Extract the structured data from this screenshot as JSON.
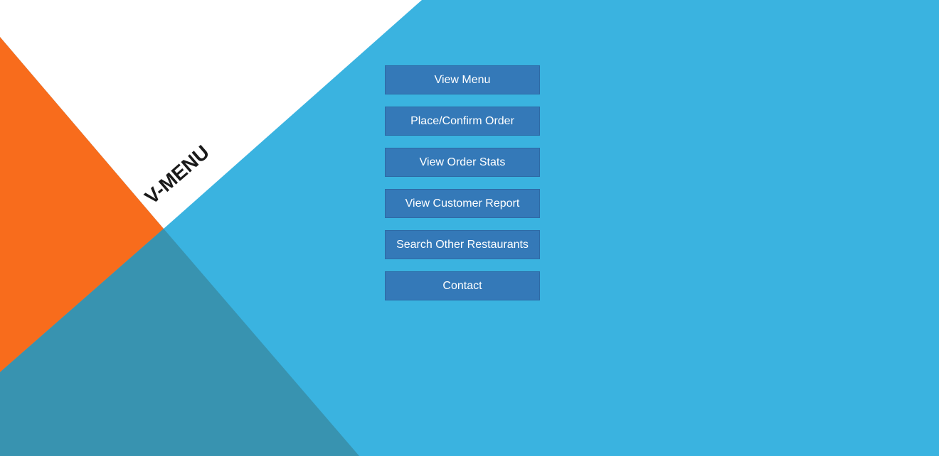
{
  "logo": {
    "text": "V-MENU"
  },
  "colors": {
    "background": "#3ab3e0",
    "orange": "#f86c1c",
    "teal": "#3893b0",
    "white": "#ffffff",
    "button": "#3479b8",
    "button_text": "#ffffff"
  },
  "menu": {
    "items": [
      {
        "label": "View Menu"
      },
      {
        "label": "Place/Confirm Order"
      },
      {
        "label": "View Order Stats"
      },
      {
        "label": "View Customer Report"
      },
      {
        "label": "Search Other Restaurants"
      },
      {
        "label": "Contact"
      }
    ]
  }
}
